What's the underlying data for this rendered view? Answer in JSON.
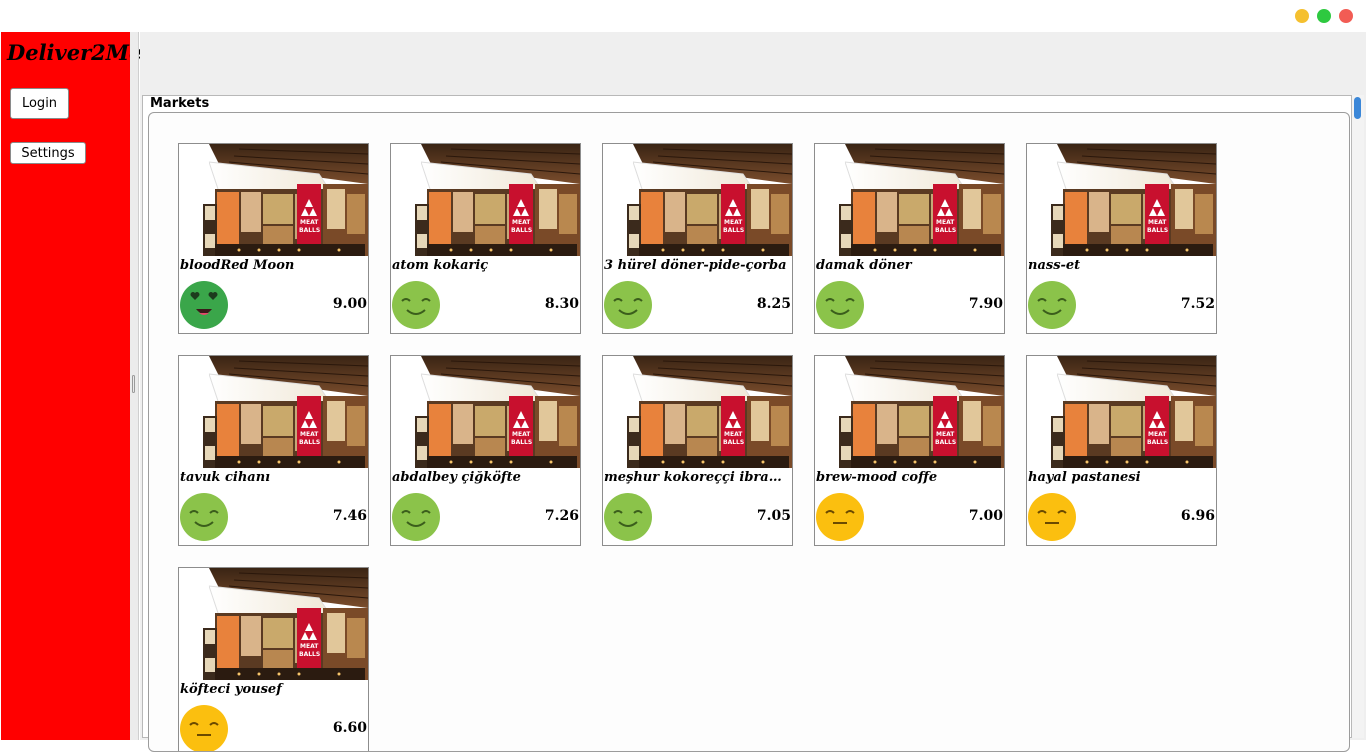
{
  "app": {
    "brand": "Deliver2Me"
  },
  "window_controls": {
    "colors": {
      "minimize": "#f5c02f",
      "maximize": "#2ec940",
      "close": "#f25c54"
    }
  },
  "sidebar": {
    "color": "#ff0000",
    "login_label": "Login",
    "settings_label": "Settings"
  },
  "markets": {
    "title": "Markets",
    "items": [
      {
        "name": "bloodRed Moon",
        "score": "9.00",
        "mood": "love"
      },
      {
        "name": "atom kokariç",
        "score": "8.30",
        "mood": "happy"
      },
      {
        "name": "3 hürel döner-pide-çorba",
        "score": "8.25",
        "mood": "happy"
      },
      {
        "name": "damak döner",
        "score": "7.90",
        "mood": "happy"
      },
      {
        "name": "nass-et",
        "score": "7.52",
        "mood": "happy"
      },
      {
        "name": "tavuk cihanı",
        "score": "7.46",
        "mood": "happy"
      },
      {
        "name": "abdalbey çiğköfte",
        "score": "7.26",
        "mood": "happy"
      },
      {
        "name": "meşhur kokoreççi ibrahim...",
        "score": "7.05",
        "mood": "happy"
      },
      {
        "name": "brew-mood coffe",
        "score": "7.00",
        "mood": "neutral"
      },
      {
        "name": "hayal pastanesi",
        "score": "6.96",
        "mood": "neutral"
      },
      {
        "name": "köfteci yousef",
        "score": "6.60",
        "mood": "neutral"
      }
    ],
    "mood_colors": {
      "love": "#3aa64a",
      "happy": "#8bc34a",
      "neutral": "#fbbf0f"
    }
  }
}
